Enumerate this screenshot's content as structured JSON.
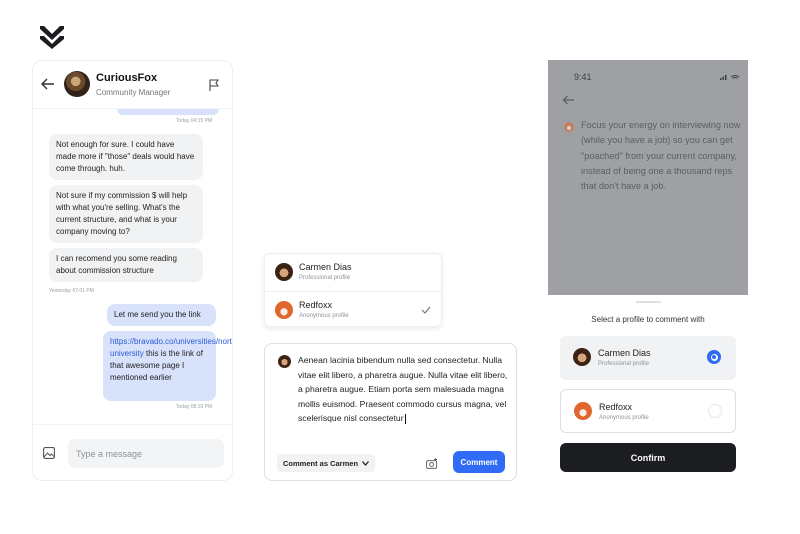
{
  "chat": {
    "name": "CuriousFox",
    "role": "Community Manager",
    "messages": [
      {
        "text": "Today 04:15 PM"
      },
      {
        "text": "Not enough for sure. I could have made more if \"those\" deals would have come through. huh."
      },
      {
        "text": "Not sure if my commission $ will help with what you're selling. What's the current structure, and what is your company moving to?"
      },
      {
        "text": "I can recomend you some reading about commission structure"
      },
      {
        "text": "Yesterday 07:01 PM"
      },
      {
        "text": "Let me send you the link"
      },
      {
        "link": "https://bravado.co/universities/northwood-university",
        "text": " this is the link of that awesome page I mentioned earlier"
      },
      {
        "text": "Today 08:10 PM"
      }
    ],
    "input_placeholder": "Type a message"
  },
  "profiles": {
    "carmen": {
      "name": "Carmen Dias",
      "sub": "Professional profile"
    },
    "redfoxx": {
      "name": "Redfoxx",
      "sub": "Anonymous profile"
    }
  },
  "comment": {
    "text": "Aenean lacinia bibendum nulla sed consectetur. Nulla vitae elit libero, a pharetra augue. Nulla vitae elit libero, a pharetra augue. Etiam porta sem malesuada magna mollis euismod. Praesent commodo cursus magna, vel scelerisque nisl consectetur",
    "comment_as": "Comment as Carmen",
    "button": "Comment"
  },
  "phone": {
    "time": "9:41",
    "post_text": "Focus your energy on interviewing now (while you have a job) so you can get \"poached\" from your current company, instead of being one a thousand reps that don't have a job.",
    "sheet_title": "Select a profile to comment with",
    "confirm": "Confirm"
  },
  "colors": {
    "accent": "#2f6bf5",
    "bubble_out": "#d8e2fb",
    "bubble_in": "#f1f2f4",
    "dark_button": "#1b1d21"
  }
}
